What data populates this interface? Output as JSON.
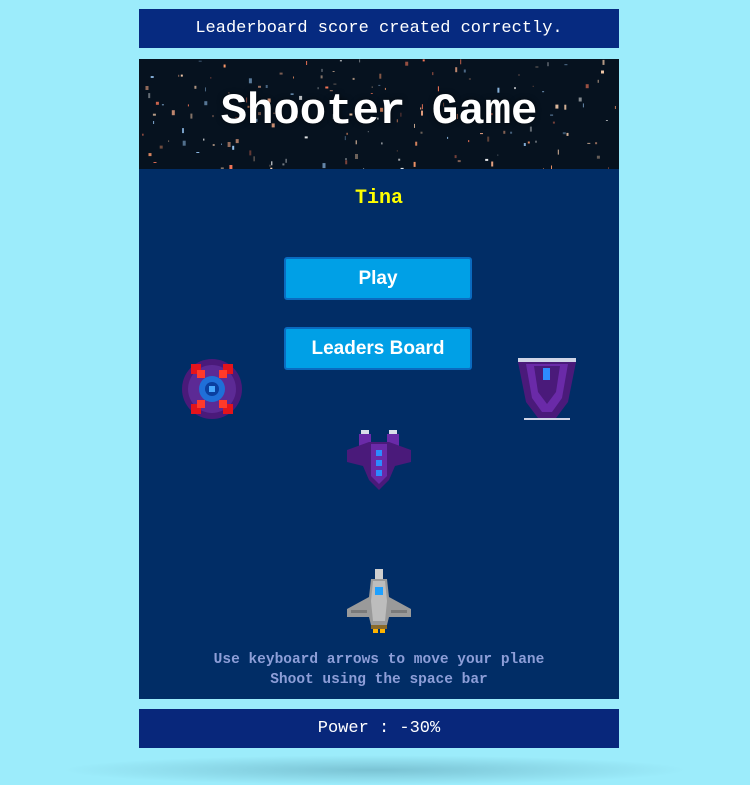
{
  "status_message": "Leaderboard score created correctly.",
  "game": {
    "title": "Shooter Game",
    "player_name": "Tina",
    "buttons": {
      "play": "Play",
      "leaders_board": "Leaders Board"
    },
    "instructions": [
      "Use keyboard arrows to move your plane",
      "Shoot using the space bar"
    ]
  },
  "power_text": "Power : -30%",
  "sprites": {
    "left_enemy": "round-mine-enemy-icon",
    "right_enemy": "shield-enemy-icon",
    "center_enemy": "purple-fighter-enemy-icon",
    "player_plane": "grey-jet-player-icon"
  },
  "colors": {
    "page_background": "#9cecfb",
    "bar_background": "#062a80",
    "game_background": "#012d66",
    "button_fill": "#00a0e6",
    "player_name": "#ffff00",
    "instructions": "#8d9ed8"
  }
}
